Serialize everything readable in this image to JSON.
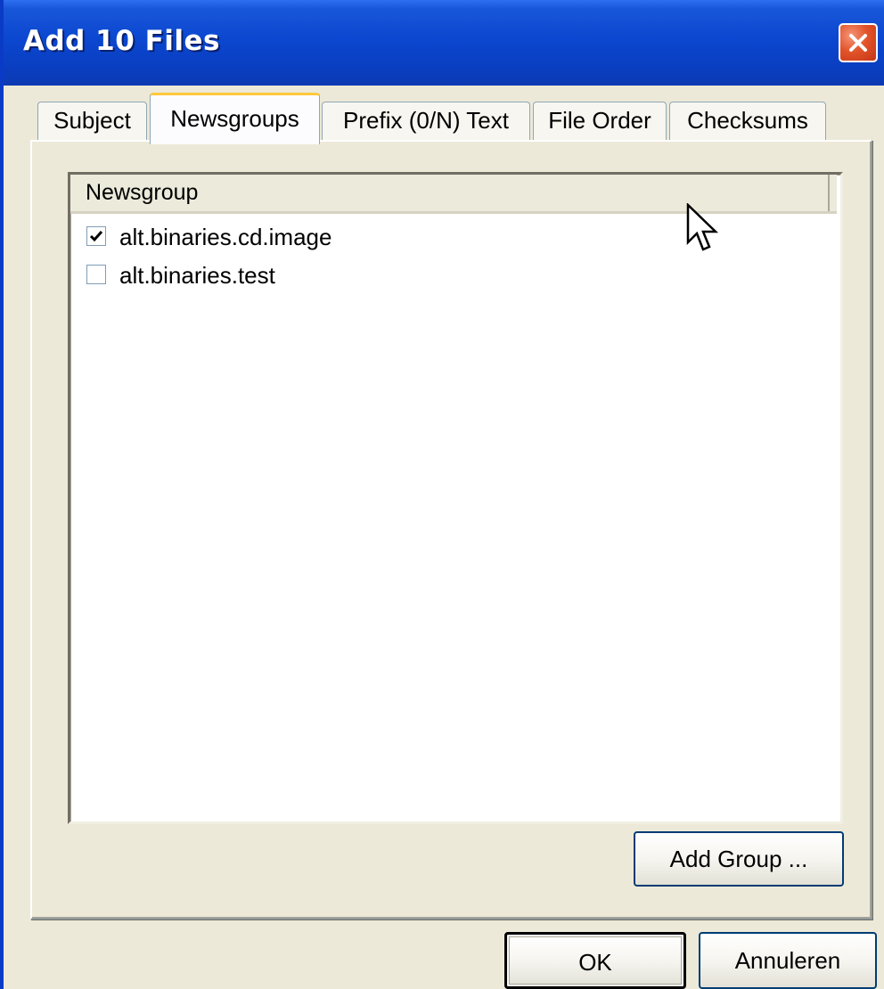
{
  "window": {
    "title": "Add 10 Files"
  },
  "tabs": [
    {
      "label": "Subject",
      "active": false
    },
    {
      "label": "Newsgroups",
      "active": true
    },
    {
      "label": "Prefix (0/N) Text",
      "active": false
    },
    {
      "label": "File Order",
      "active": false
    },
    {
      "label": "Checksums",
      "active": false
    }
  ],
  "newsgroups": {
    "column_header": "Newsgroup",
    "items": [
      {
        "label": "alt.binaries.cd.image",
        "checked": true
      },
      {
        "label": "alt.binaries.test",
        "checked": false
      }
    ],
    "add_group_label": "Add Group ..."
  },
  "buttons": {
    "ok_label": "OK",
    "cancel_label": "Annuleren"
  },
  "icons": {
    "close": "close-icon",
    "check": "check-icon",
    "cursor": "mouse-pointer-icon"
  },
  "colors": {
    "titlebar": "#0A3EC0",
    "close_button": "#E2542B",
    "dialog_background": "#ECE9D8",
    "active_tab_accent": "#FFC83C"
  }
}
